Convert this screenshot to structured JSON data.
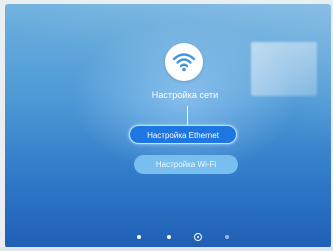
{
  "screen": {
    "title": "Настройка сети",
    "icon": "wifi-icon"
  },
  "buttons": {
    "ethernet_label": "Настройка Ethernet",
    "wifi_label": "Настройка Wi-Fi"
  },
  "pager": {
    "total": 4,
    "active_index": 2
  },
  "colors": {
    "background_top": "#6eb0de",
    "background_bottom": "#1f5fb6",
    "button_selected": "#1e76e0",
    "button_normal": "#7cc2f0"
  }
}
